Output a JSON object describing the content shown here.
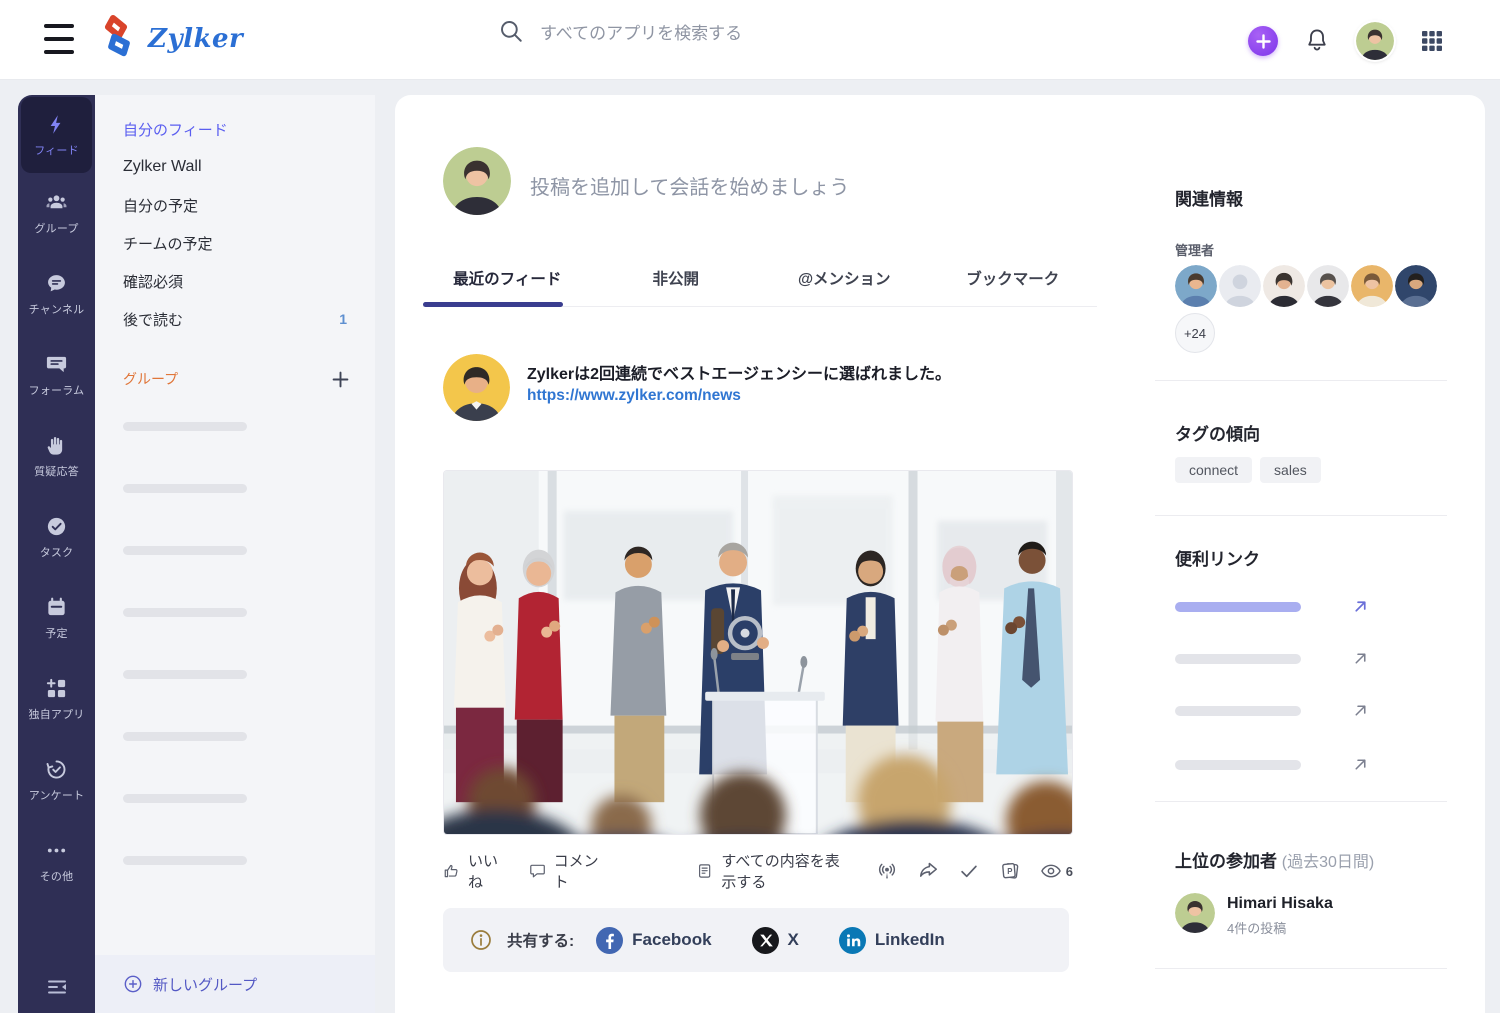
{
  "header": {
    "logo_text": "Zylker",
    "search_placeholder": "すべてのアプリを検索する"
  },
  "rail": {
    "items": [
      {
        "label": "フィード",
        "icon": "feed-bolt-icon",
        "active": true
      },
      {
        "label": "グループ",
        "icon": "groups-icon"
      },
      {
        "label": "チャンネル",
        "icon": "channels-icon"
      },
      {
        "label": "フォーラム",
        "icon": "forums-icon"
      },
      {
        "label": "質疑応答",
        "icon": "qna-hand-icon"
      },
      {
        "label": "タスク",
        "icon": "tasks-check-icon"
      },
      {
        "label": "予定",
        "icon": "events-calendar-icon"
      },
      {
        "label": "独自アプリ",
        "icon": "custom-apps-icon"
      },
      {
        "label": "アンケート",
        "icon": "survey-icon"
      },
      {
        "label": "その他",
        "icon": "more-dots-icon"
      }
    ]
  },
  "sidebar": {
    "items": [
      {
        "label": "自分のフィード",
        "active": true
      },
      {
        "label": "Zylker Wall"
      },
      {
        "label": "自分の予定"
      },
      {
        "label": "チームの予定"
      },
      {
        "label": "確認必須"
      },
      {
        "label": "後で読む",
        "badge": "1"
      }
    ],
    "group_section_label": "グループ",
    "skeleton_count": 8,
    "new_group_label": "新しいグループ"
  },
  "composer": {
    "placeholder": "投稿を追加して会話を始めましょう"
  },
  "tabs": [
    {
      "label": "最近のフィード",
      "active": true
    },
    {
      "label": "非公開"
    },
    {
      "label": "@メンション"
    },
    {
      "label": "ブックマーク"
    }
  ],
  "post": {
    "text": "Zylkerは2回連続でベストエージェンシーに選ばれました。",
    "link": "https://www.zylker.com/news",
    "actions": {
      "like": "いいね",
      "comment": "コメント",
      "view_all": "すべての内容を表示する",
      "view_count": "6"
    },
    "share": {
      "label": "共有する:",
      "networks": [
        "Facebook",
        "X",
        "LinkedIn"
      ]
    }
  },
  "right_panel": {
    "title": "関連情報",
    "admins_label": "管理者",
    "admins_more": "+24",
    "tags_title": "タグの傾向",
    "tags": [
      "connect",
      "sales"
    ],
    "links_title": "便利リンク",
    "links_count": 4,
    "participants_title": "上位の参加者",
    "participants_period": "(過去30日間)",
    "participant": {
      "name": "Himari Hisaka",
      "meta": "4件の投稿"
    }
  },
  "colors": {
    "rail_bg": "#2f2f55",
    "rail_active_fg": "#8183f4",
    "sidebar_active": "#5a5ef0",
    "group_label_orange": "#e0763a",
    "tab_underline": "#3a3d8f",
    "link_blue": "#3076d2",
    "plus_button_purple": "#8f45ee",
    "facebook_blue": "#4267b2",
    "x_black": "#17181c",
    "linkedin_blue": "#0a78b5",
    "badge_blue": "#5e8fd0"
  }
}
